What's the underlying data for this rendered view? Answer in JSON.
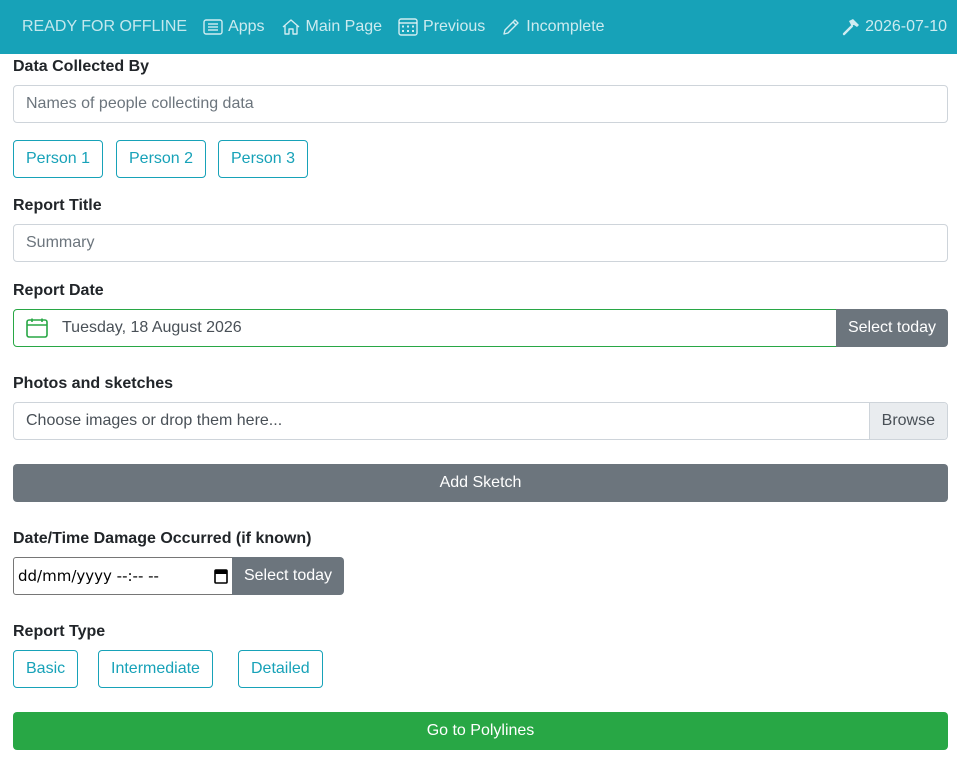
{
  "nav": {
    "brand": "READY FOR OFFLINE",
    "apps": "Apps",
    "main_page": "Main Page",
    "previous": "Previous",
    "incomplete": "Incomplete",
    "date": "2026-07-10"
  },
  "form": {
    "collected_by": {
      "label": "Data Collected By",
      "placeholder": "Names of people collecting data",
      "people": [
        "Person 1",
        "Person 2",
        "Person 3"
      ]
    },
    "report_title": {
      "label": "Report Title",
      "placeholder": "Summary"
    },
    "report_date": {
      "label": "Report Date",
      "value": "Tuesday, 18 August 2026",
      "today_button": "Select today"
    },
    "photos": {
      "label": "Photos and sketches",
      "placeholder": "Choose images or drop them here...",
      "browse": "Browse",
      "add_sketch": "Add Sketch"
    },
    "damage_datetime": {
      "label": "Date/Time Damage Occurred (if known)",
      "value": "dd/mm/yyyy --:-- --",
      "today_button": "Select today"
    },
    "report_type": {
      "label": "Report Type",
      "options": [
        "Basic",
        "Intermediate",
        "Detailed"
      ]
    },
    "submit": "Go to Polylines"
  },
  "colors": {
    "navbar": "#17a2b8",
    "accent": "#17a2b8",
    "secondary": "#6c757d",
    "success": "#28a745"
  }
}
